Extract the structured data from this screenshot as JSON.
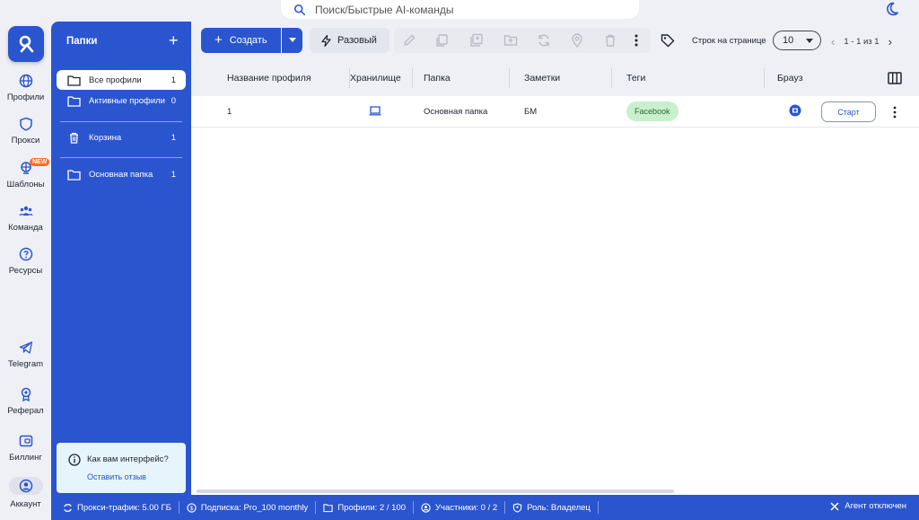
{
  "search": {
    "placeholder": "Поиск/Быстрые AI-команды"
  },
  "rail": {
    "items": [
      {
        "label": "Профили"
      },
      {
        "label": "Прокси"
      },
      {
        "label": "Шаблоны",
        "badge": "NEW"
      },
      {
        "label": "Команда"
      },
      {
        "label": "Ресурсы"
      },
      {
        "label": "Telegram"
      },
      {
        "label": "Реферал"
      },
      {
        "label": "Биллинг"
      },
      {
        "label": "Аккаунт"
      }
    ]
  },
  "folders": {
    "title": "Папки",
    "items": [
      {
        "label": "Все профили",
        "count": "1"
      },
      {
        "label": "Активные профили",
        "count": "0"
      },
      {
        "label": "Корзина",
        "count": "1"
      },
      {
        "label": "Основная папка",
        "count": "1"
      }
    ],
    "feedback": {
      "question": "Как вам интерфейс?",
      "link": "Оставить отзыв"
    }
  },
  "toolbar": {
    "create_label": "Создать",
    "once_label": "Разовый",
    "rows_label": "Строк на странице",
    "rows_value": "10",
    "pager": "1 - 1 из 1"
  },
  "table": {
    "columns": [
      "Название профиля",
      "Хранилище",
      "Папка",
      "Заметки",
      "Теги",
      "Брауз"
    ],
    "rows": [
      {
        "name": "1",
        "folder": "Основная папка",
        "notes": "БМ",
        "tag": "Facebook",
        "action": "Старт"
      }
    ]
  },
  "status": {
    "proxy": "Прокси-трафик: 5.00 ГБ",
    "subscription": "Подписка: Pro_100 monthly",
    "profiles": "Профили: 2 / 100",
    "members": "Участники: 0 / 2",
    "role": "Роль: Владелец",
    "agent": "Агент отключен"
  },
  "colors": {
    "accent": "#2a55cf",
    "tag_bg": "#c8f0cc",
    "badge_new": "#ff6b2c"
  }
}
